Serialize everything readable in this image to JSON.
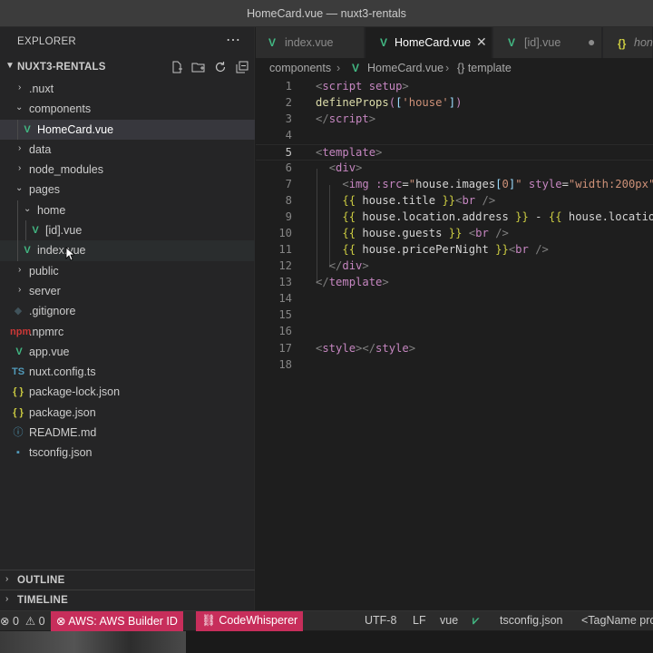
{
  "window": {
    "title": "HomeCard.vue — nuxt3-rentals"
  },
  "sidebar": {
    "header": "EXPLORER",
    "more_icon": "⋯",
    "project": "NUXT3-RENTALS",
    "tree": [
      {
        "label": ".nuxt",
        "type": "folder",
        "state": "closed"
      },
      {
        "label": "components",
        "type": "folder",
        "state": "open"
      },
      {
        "label": "HomeCard.vue",
        "type": "vue"
      },
      {
        "label": "data",
        "type": "folder",
        "state": "closed"
      },
      {
        "label": "node_modules",
        "type": "folder",
        "state": "closed"
      },
      {
        "label": "pages",
        "type": "folder",
        "state": "open"
      },
      {
        "label": "home",
        "type": "folder",
        "state": "open"
      },
      {
        "label": "[id].vue",
        "type": "vue"
      },
      {
        "label": "index.vue",
        "type": "vue"
      },
      {
        "label": "public",
        "type": "folder",
        "state": "closed"
      },
      {
        "label": "server",
        "type": "folder",
        "state": "closed"
      },
      {
        "label": ".gitignore",
        "type": "git"
      },
      {
        "label": ".npmrc",
        "type": "npm"
      },
      {
        "label": "app.vue",
        "type": "vue"
      },
      {
        "label": "nuxt.config.ts",
        "type": "ts"
      },
      {
        "label": "package-lock.json",
        "type": "json"
      },
      {
        "label": "package.json",
        "type": "json"
      },
      {
        "label": "README.md",
        "type": "info"
      },
      {
        "label": "tsconfig.json",
        "type": "tsconfig"
      }
    ],
    "outline": "OUTLINE",
    "timeline": "TIMELINE"
  },
  "tabs": [
    {
      "label": "index.vue",
      "icon": "vue-icon"
    },
    {
      "label": "HomeCard.vue",
      "icon": "vue-icon",
      "active": true
    },
    {
      "label": "[id].vue",
      "icon": "vue-icon"
    },
    {
      "label": "hon",
      "icon": "json-icon"
    }
  ],
  "breadcrumb": {
    "folder": "components",
    "file": "HomeCard.vue",
    "symbol": "{} template"
  },
  "editor": {
    "current_line": 5,
    "line_numbers": [
      "1",
      "2",
      "3",
      "4",
      "5",
      "6",
      "7",
      "8",
      "9",
      "10",
      "11",
      "12",
      "13",
      "14",
      "15",
      "16",
      "17",
      "18"
    ]
  },
  "statusbar": {
    "errors": "0",
    "warnings": "0",
    "aws": "AWS: AWS Builder ID",
    "codewhisperer": "CodeWhisperer",
    "encoding": "UTF-8",
    "eol": "LF",
    "language": "vue",
    "tsconfig": "tsconfig.json",
    "tagname": "<TagName pro"
  },
  "colors": {
    "accent_vue": "#42b883",
    "status_warn": "#c72e5b",
    "editor_bg": "#1e1e1e",
    "sidebar_bg": "#252526"
  }
}
